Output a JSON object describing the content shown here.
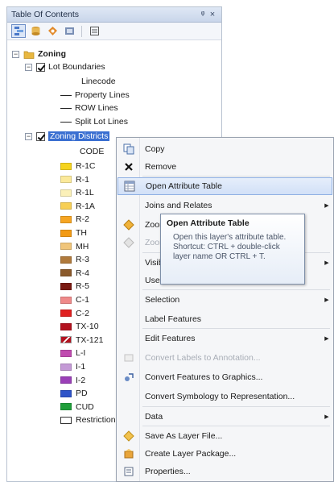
{
  "toc": {
    "title": "Table Of Contents",
    "pin_glyph": "ᵠ",
    "close_glyph": "×",
    "toolbar_icons": [
      "list-by-drawing-order-icon",
      "list-by-source-icon",
      "list-by-visibility-icon",
      "list-by-selection-icon",
      "options-icon"
    ],
    "group": {
      "name": "Zoning",
      "expander": "⊟"
    },
    "lot_layer": {
      "name": "Lot Boundaries",
      "expander": "⊟",
      "field": "Linecode",
      "classes": [
        "Property Lines",
        "ROW Lines",
        "Split Lot Lines"
      ]
    },
    "zoning_layer": {
      "name": "Zoning Districts",
      "expander": "⊟",
      "field": "CODE",
      "classes": [
        {
          "label": "R-1C",
          "color": "#f5d31e"
        },
        {
          "label": "R-1",
          "color": "#fbe99a"
        },
        {
          "label": "R-1L",
          "color": "#fbf0b8"
        },
        {
          "label": "R-1A",
          "color": "#f7cf55"
        },
        {
          "label": "R-2",
          "color": "#f6a523"
        },
        {
          "label": "TH",
          "color": "#f29a14"
        },
        {
          "label": "MH",
          "color": "#f0c57a"
        },
        {
          "label": "R-3",
          "color": "#b07a3c"
        },
        {
          "label": "R-4",
          "color": "#8b5a2b"
        },
        {
          "label": "R-5",
          "color": "#7a1a12"
        },
        {
          "label": "C-1",
          "color": "#ef8a8a"
        },
        {
          "label": "C-2",
          "color": "#e02020"
        },
        {
          "label": "TX-10",
          "color": "#b3121f"
        },
        {
          "label": "TX-121",
          "color": "hatch"
        },
        {
          "label": "L-I",
          "color": "#c04bb0"
        },
        {
          "label": "I-1",
          "color": "#c49ad6"
        },
        {
          "label": "I-2",
          "color": "#9b40b8"
        },
        {
          "label": "PD",
          "color": "#2f54c8"
        },
        {
          "label": "CUD",
          "color": "#1f9e3a"
        },
        {
          "label": "Restrictions",
          "color": "box"
        }
      ]
    }
  },
  "menu": {
    "items": [
      {
        "label": "Copy",
        "icon": "copy-icon",
        "submenu": false,
        "disabled": false
      },
      {
        "label": "Remove",
        "icon": "remove-icon",
        "submenu": false,
        "disabled": false
      },
      {
        "label": "Open Attribute Table",
        "icon": "attribute-table-icon",
        "submenu": false,
        "disabled": false,
        "highlighted": true
      },
      {
        "label": "Joins and Relates",
        "icon": "",
        "submenu": true,
        "disabled": false
      },
      {
        "label": "Zoom To Layer",
        "icon": "zoom-to-layer-icon",
        "submenu": false,
        "disabled": false
      },
      {
        "label": "Zoom To Make Visible",
        "icon": "zoom-visible-icon",
        "submenu": false,
        "disabled": true
      },
      {
        "label": "Visible Scale Range",
        "icon": "",
        "submenu": true,
        "disabled": false
      },
      {
        "label": "Use Symbol Levels",
        "icon": "",
        "submenu": false,
        "disabled": false
      },
      {
        "label": "Selection",
        "icon": "",
        "submenu": true,
        "disabled": false
      },
      {
        "label": "Label Features",
        "icon": "",
        "submenu": false,
        "disabled": false
      },
      {
        "label": "Edit Features",
        "icon": "",
        "submenu": true,
        "disabled": false
      },
      {
        "label": "Convert Labels to Annotation...",
        "icon": "convert-labels-icon",
        "submenu": false,
        "disabled": true
      },
      {
        "label": "Convert Features to Graphics...",
        "icon": "convert-features-icon",
        "submenu": false,
        "disabled": false
      },
      {
        "label": "Convert Symbology to Representation...",
        "icon": "",
        "submenu": false,
        "disabled": false
      },
      {
        "label": "Data",
        "icon": "",
        "submenu": true,
        "disabled": false
      },
      {
        "label": "Save As Layer File...",
        "icon": "save-layer-icon",
        "submenu": false,
        "disabled": false
      },
      {
        "label": "Create Layer Package...",
        "icon": "layer-package-icon",
        "submenu": false,
        "disabled": false
      },
      {
        "label": "Properties...",
        "icon": "properties-icon",
        "submenu": false,
        "disabled": false
      }
    ],
    "submenu_arrow": "▶"
  },
  "tooltip": {
    "title": "Open Attribute Table",
    "body": "Open this layer's attribute table. Shortcut: CTRL + double-click layer name OR CTRL + T."
  }
}
